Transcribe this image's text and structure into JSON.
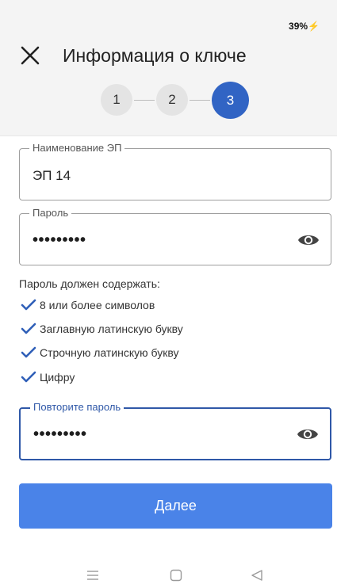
{
  "status": {
    "battery": "39%",
    "charging_icon": "bolt-icon"
  },
  "header": {
    "title": "Информация о ключе",
    "close_icon": "close-icon"
  },
  "stepper": {
    "steps": [
      "1",
      "2",
      "3"
    ],
    "active_step": 3,
    "active_color": "#3164c4"
  },
  "form": {
    "name_field": {
      "label": "Наименование ЭП",
      "value": "ЭП 14"
    },
    "password_field": {
      "label": "Пароль",
      "value": "•••••••••",
      "toggle_icon": "eye-icon"
    },
    "requirements": {
      "title": "Пароль должен содержать:",
      "items": [
        "8 или более символов",
        "Заглавную латинскую букву",
        "Строчную латинскую букву",
        "Цифру"
      ],
      "check_color": "#2f5fb8"
    },
    "repeat_field": {
      "label": "Повторите пароль",
      "value": "•••••••••",
      "toggle_icon": "eye-icon"
    }
  },
  "actions": {
    "next_label": "Далее",
    "next_color": "#4a83e8"
  },
  "navbar": {
    "icons": [
      "menu-icon",
      "home-icon",
      "back-icon"
    ]
  }
}
